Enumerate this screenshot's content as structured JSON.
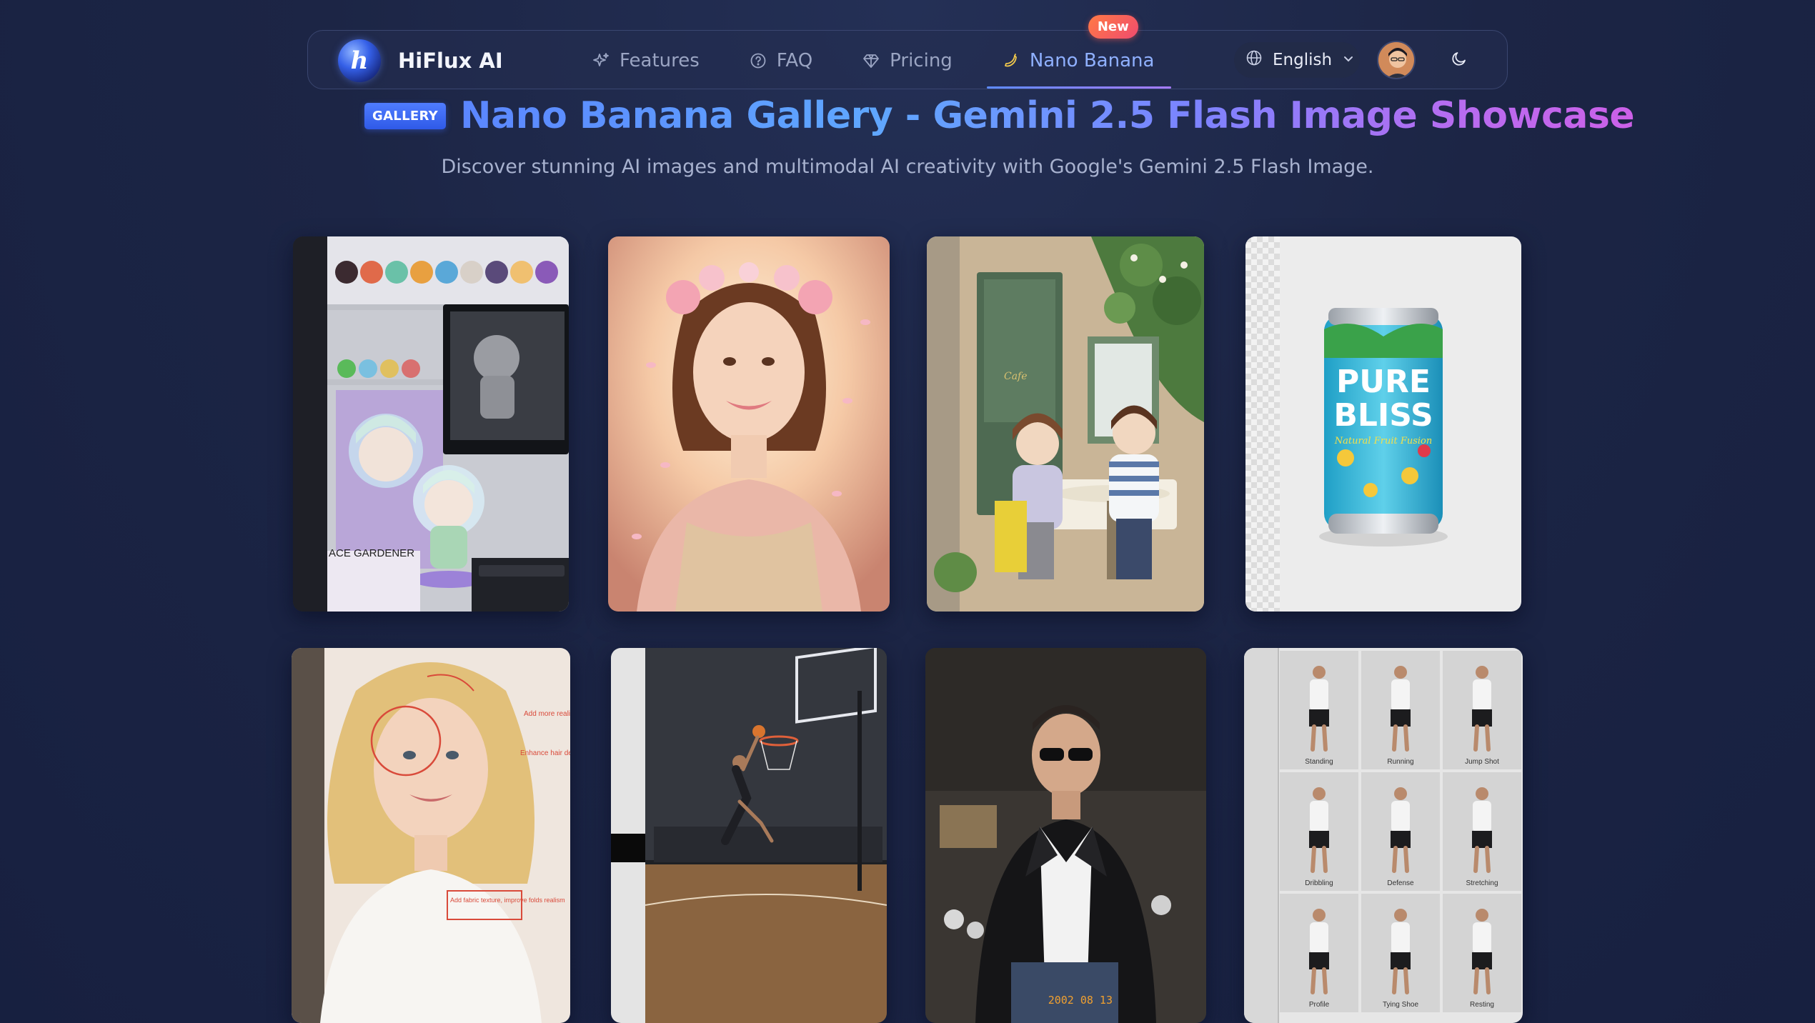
{
  "navbar": {
    "brand": {
      "name": "HiFlux AI",
      "logo_letter": "h"
    },
    "items": [
      {
        "label": "Features",
        "icon": "sparkle-icon"
      },
      {
        "label": "FAQ",
        "icon": "question-circle-icon"
      },
      {
        "label": "Pricing",
        "icon": "diamond-icon"
      },
      {
        "label": "Nano Banana",
        "icon": "banana-icon",
        "badge": "New",
        "active": true
      }
    ],
    "language": {
      "label": "English",
      "icon": "globe-icon"
    },
    "theme_toggle_icon": "moon-icon"
  },
  "header": {
    "tag": "GALLERY",
    "title": "Nano Banana Gallery - Gemini 2.5 Flash Image Showcase",
    "subtitle": "Discover stunning AI images and multimodal AI creativity with Google's Gemini 2.5 Flash Image."
  },
  "gallery": {
    "cards": [
      {
        "id": "card-figurine",
        "caption_text": "ACE GARDENER"
      },
      {
        "id": "card-portrait-flowers"
      },
      {
        "id": "card-cafe-illustration",
        "caption_text": "Cafe"
      },
      {
        "id": "card-can-mockup",
        "can_text_1": "PURE",
        "can_text_2": "BLISS",
        "can_text_3": "Natural Fruit Fusion"
      },
      {
        "id": "card-annotated-portrait",
        "notes": [
          "Add more realistic hair strands",
          "Enhance hair definition",
          "Add fabric texture, improve folds realism"
        ]
      },
      {
        "id": "card-basketball-dunk"
      },
      {
        "id": "card-leather-jacket",
        "timestamp": "2002 08 13"
      },
      {
        "id": "card-pose-grid",
        "poses": [
          "Standing",
          "Running",
          "Jump Shot",
          "Dribbling",
          "Defense",
          "Stretching",
          "Profile",
          "Tying Shoe",
          "Resting"
        ]
      }
    ]
  },
  "colors": {
    "background": "#1c2545",
    "accent_blue": "#5b86ff",
    "accent_purple": "#cc60e8",
    "badge_new": "#f04b6e"
  }
}
